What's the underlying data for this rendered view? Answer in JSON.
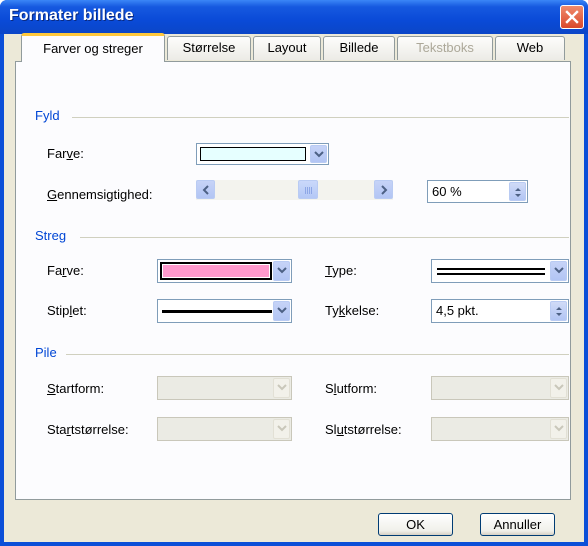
{
  "window": {
    "title": "Formater billede"
  },
  "tabs": [
    {
      "label": "Farver og streger",
      "active": true,
      "disabled": false
    },
    {
      "label": "Størrelse",
      "active": false,
      "disabled": false
    },
    {
      "label": "Layout",
      "active": false,
      "disabled": false
    },
    {
      "label": "Billede",
      "active": false,
      "disabled": false
    },
    {
      "label": "Tekstboks",
      "active": false,
      "disabled": true
    },
    {
      "label": "Web",
      "active": false,
      "disabled": false
    }
  ],
  "fill": {
    "section": "Fyld",
    "color_label": "Farve:",
    "color_value": "#e6ffff",
    "transparency_label": "Gennemsigtighed:",
    "transparency_value": "60 %",
    "transparency_fraction": 0.6
  },
  "line": {
    "section": "Streg",
    "color_label": "Farve:",
    "color_value": "#ff99cc",
    "type_label": "Type:",
    "dashed_label": "Stiplet:",
    "weight_label": "Tykkelse:",
    "weight_value": "4,5 pkt."
  },
  "arrows": {
    "section": "Pile",
    "begin_style_label": "Startform:",
    "end_style_label": "Slutform:",
    "begin_size_label": "Startstørrelse:",
    "end_size_label": "Slutstørrelse:"
  },
  "buttons": {
    "ok": "OK",
    "cancel": "Annuller"
  }
}
